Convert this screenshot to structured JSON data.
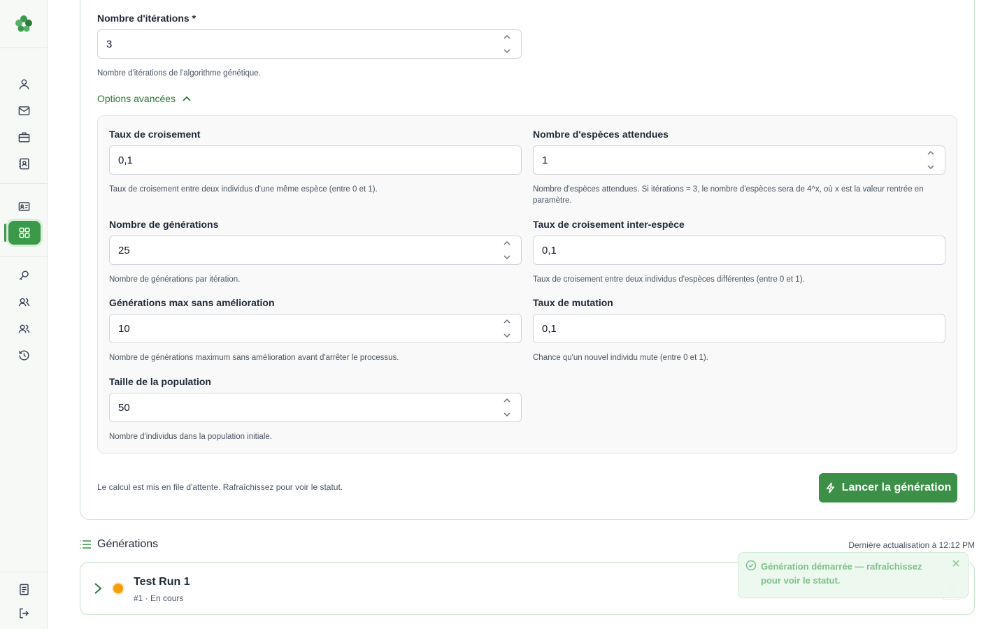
{
  "form": {
    "iterations": {
      "label": "Nombre d'itérations *",
      "value": "3",
      "help": "Nombre d'itérations de l'algorithme génétique."
    },
    "advanced_toggle": "Options avancées",
    "crossover_rate": {
      "label": "Taux de croisement",
      "value": "0,1",
      "help": "Taux de croisement entre deux individus d'une même espèce (entre 0 et 1)."
    },
    "expected_species": {
      "label": "Nombre d'espèces attendues",
      "value": "1",
      "help": "Nombre d'espèces attendues. Si itérations = 3, le nombre d'espèces sera de 4^x, où x est la valeur rentrée en paramètre."
    },
    "generations": {
      "label": "Nombre de générations",
      "value": "25",
      "help": "Nombre de générations par itération."
    },
    "inter_species_crossover": {
      "label": "Taux de croisement inter-espèce",
      "value": "0,1",
      "help": "Taux de croisement entre deux individus d'espèces différentes (entre 0 et 1)."
    },
    "max_no_improvement": {
      "label": "Générations max sans amélioration",
      "value": "10",
      "help": "Nombre de générations maximum sans amélioration avant d'arrêter le processus."
    },
    "mutation_rate": {
      "label": "Taux de mutation",
      "value": "0,1",
      "help": "Chance qu'un nouvel individu mute (entre 0 et 1)."
    },
    "population_size": {
      "label": "Taille de la population",
      "value": "50",
      "help": "Nombre d'individus dans la population initiale."
    },
    "footer_note": "Le calcul est mis en file d'attente. Rafraîchissez pour voir le statut.",
    "launch_label": "Lancer la génération"
  },
  "generations": {
    "title": "Générations",
    "last_update": "Dernière actualisation à 12:12 PM",
    "items": [
      {
        "name": "Test Run 1",
        "subtitle": "#1 · En cours",
        "status_color": "#f59e0b"
      }
    ]
  },
  "toast": {
    "message": "Génération démarrée — rafraîchissez pour voir le statut."
  },
  "colors": {
    "accent": "#3b8f47",
    "status_running": "#f59e0b"
  }
}
